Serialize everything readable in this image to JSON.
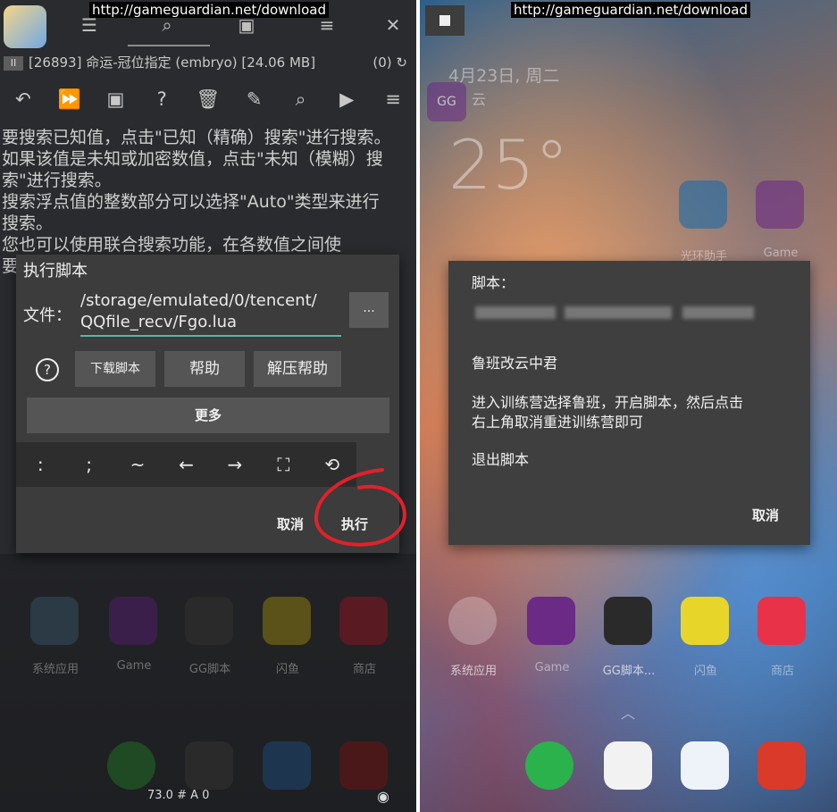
{
  "url_label": "http://gameguardian.net/download",
  "left": {
    "process_info": "[26893] 命运-冠位指定 (embryo) [24.06 MB]",
    "process_count": "(0)",
    "help_lines": [
      "要搜索已知值，点击\"已知（精确）搜索\"进行搜索。",
      "如果该值是未知或加密数值，点击\"未知（模糊）搜",
      "索\"进行搜索。",
      "搜索浮点值的整数部分可以选择\"Auto\"类型来进行",
      "搜索。",
      "您也可以使用联合搜索功能，在各数值之间使",
      "要"
    ],
    "dialog": {
      "title": "执行脚本",
      "file_label": "文件：",
      "file_path_line1": "/storage/emulated/0/tencent/",
      "file_path_line2": "QQfile_recv/Fgo.lua",
      "browse_label": "...",
      "help_icon": "?",
      "download_label": "下载脚本",
      "help_label": "帮助",
      "unzip_help_label": "解压帮助",
      "more_label": "更多",
      "keys": [
        ":",
        ";",
        "~",
        "←",
        "→",
        "⛶",
        "⟲"
      ],
      "cancel_label": "取消",
      "execute_label": "执行"
    },
    "home_labels": [
      "系统应用",
      "Game",
      "GG脚本",
      "闪鱼",
      "商店"
    ],
    "status_text": "73.0 # A 0"
  },
  "right": {
    "date": "4月23日, 周二",
    "weather": "云",
    "temperature": "25°",
    "top_app_labels": [
      "光环助手",
      "Game"
    ],
    "dialog": {
      "title": "脚本：",
      "line_script_name": "鲁班改云中君",
      "instruction_line1": "进入训练营选择鲁班，开启脚本，然后点击",
      "instruction_line2": "右上角取消重进训练营即可",
      "exit_label": "退出脚本",
      "cancel_label": "取消"
    },
    "home_labels": [
      "系统应用",
      "Game",
      "GG脚本...",
      "闪鱼",
      "商店"
    ]
  }
}
